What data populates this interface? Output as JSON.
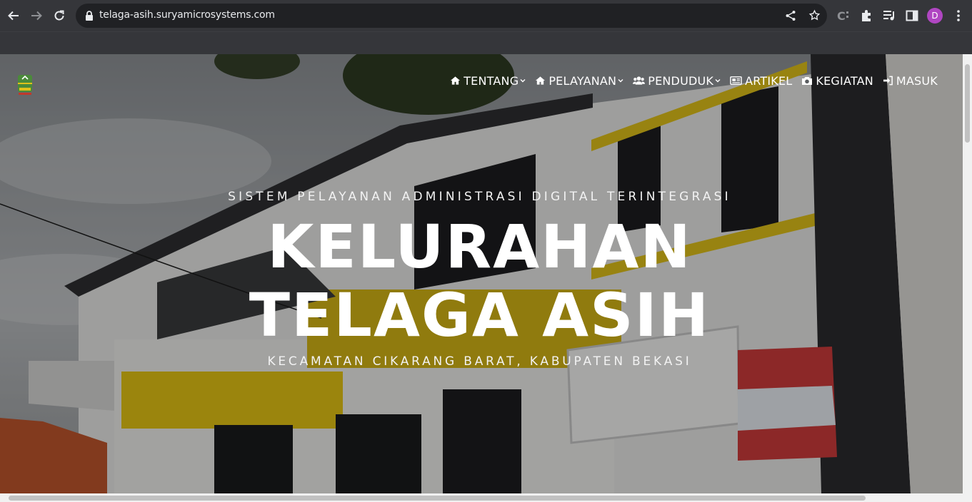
{
  "browser": {
    "url": "telaga-asih.suryamicrosystems.com",
    "profile_initial": "D",
    "profile_color": "#b046c2"
  },
  "site": {
    "logo": "kabupaten-bekasi-emblem",
    "nav": [
      {
        "label": "TENTANG",
        "icon": "home-icon",
        "dropdown": true
      },
      {
        "label": "PELAYANAN",
        "icon": "home-icon",
        "dropdown": true
      },
      {
        "label": "PENDUDUK",
        "icon": "users-icon",
        "dropdown": true
      },
      {
        "label": "ARTIKEL",
        "icon": "newspaper-icon",
        "dropdown": false
      },
      {
        "label": "KEGIATAN",
        "icon": "camera-icon",
        "dropdown": false
      },
      {
        "label": "MASUK",
        "icon": "sign-in-icon",
        "dropdown": false
      }
    ]
  },
  "hero": {
    "eyebrow": "SISTEM PELAYANAN ADMINISTRASI DIGITAL TERINTEGRASI",
    "title_line1": "KELURAHAN",
    "title_line2": "TELAGA ASIH",
    "subtitle": "KECAMATAN CIKARANG BARAT, KABUPATEN BEKASI",
    "accent_color": "#f2d40a"
  }
}
